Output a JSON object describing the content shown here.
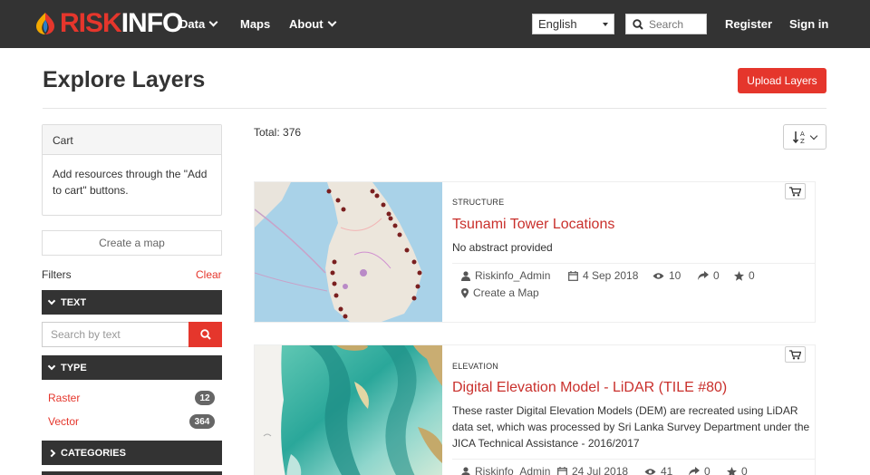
{
  "brand": {
    "logo_risk": "RISK",
    "logo_info": "INFO"
  },
  "nav": {
    "data": "Data",
    "maps": "Maps",
    "about": "About",
    "language": "English",
    "search_placeholder": "Search",
    "register": "Register",
    "signin": "Sign in"
  },
  "page": {
    "title": "Explore Layers",
    "upload": "Upload Layers"
  },
  "cart": {
    "title": "Cart",
    "body": "Add resources through the \"Add to cart\" buttons."
  },
  "sidebar": {
    "create_map": "Create a map",
    "filters": "Filters",
    "clear": "Clear",
    "text_header": "TEXT",
    "text_placeholder": "Search by text",
    "type_header": "TYPE",
    "types": [
      {
        "label": "Raster",
        "count": "12"
      },
      {
        "label": "Vector",
        "count": "364"
      }
    ],
    "categories_header": "CATEGORIES"
  },
  "results": {
    "total": "Total: 376",
    "items": [
      {
        "category": "STRUCTURE",
        "title": "Tsunami Tower Locations",
        "abstract": "No abstract provided",
        "owner": "Riskinfo_Admin",
        "date": "4 Sep 2018",
        "views": "10",
        "shares": "0",
        "rating": "0",
        "create_map": "Create a Map"
      },
      {
        "category": "ELEVATION",
        "title": "Digital Elevation Model - LiDAR (TILE #80)",
        "abstract": "These raster Digital Elevation Models (DEM) are recreated using LiDAR data set, which was processed by Sri Lanka Survey Department under the JICA Technical Assistance - 2016/2017",
        "owner": "Riskinfo_Admin",
        "date": "24 Jul 2018",
        "views": "41",
        "shares": "0",
        "rating": "0"
      }
    ]
  },
  "colors": {
    "accent": "#e5362c",
    "navbar": "#333333",
    "title_link": "#c9302c"
  },
  "icons": [
    "search-icon",
    "chevron-down-icon",
    "cart-icon",
    "user-icon",
    "calendar-icon",
    "eye-icon",
    "share-icon",
    "star-icon",
    "map-marker-icon",
    "sort-alpha-icon"
  ]
}
